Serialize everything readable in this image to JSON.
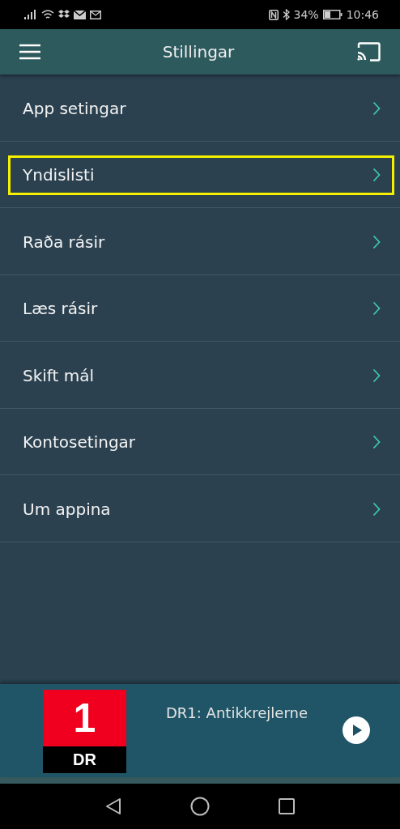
{
  "status_bar": {
    "battery": "34%",
    "time": "10:46"
  },
  "app_bar": {
    "title": "Stillingar"
  },
  "menu": [
    {
      "label": "App setingar",
      "highlighted": false
    },
    {
      "label": "Yndislisti",
      "highlighted": true
    },
    {
      "label": "Raða rásir",
      "highlighted": false
    },
    {
      "label": "Læs rásir",
      "highlighted": false
    },
    {
      "label": "Skift mál",
      "highlighted": false
    },
    {
      "label": "Kontosetingar",
      "highlighted": false
    },
    {
      "label": "Um appina",
      "highlighted": false
    }
  ],
  "player": {
    "logo_number": "1",
    "logo_text": "DR",
    "title": "DR1: Antikkrejlerne"
  }
}
